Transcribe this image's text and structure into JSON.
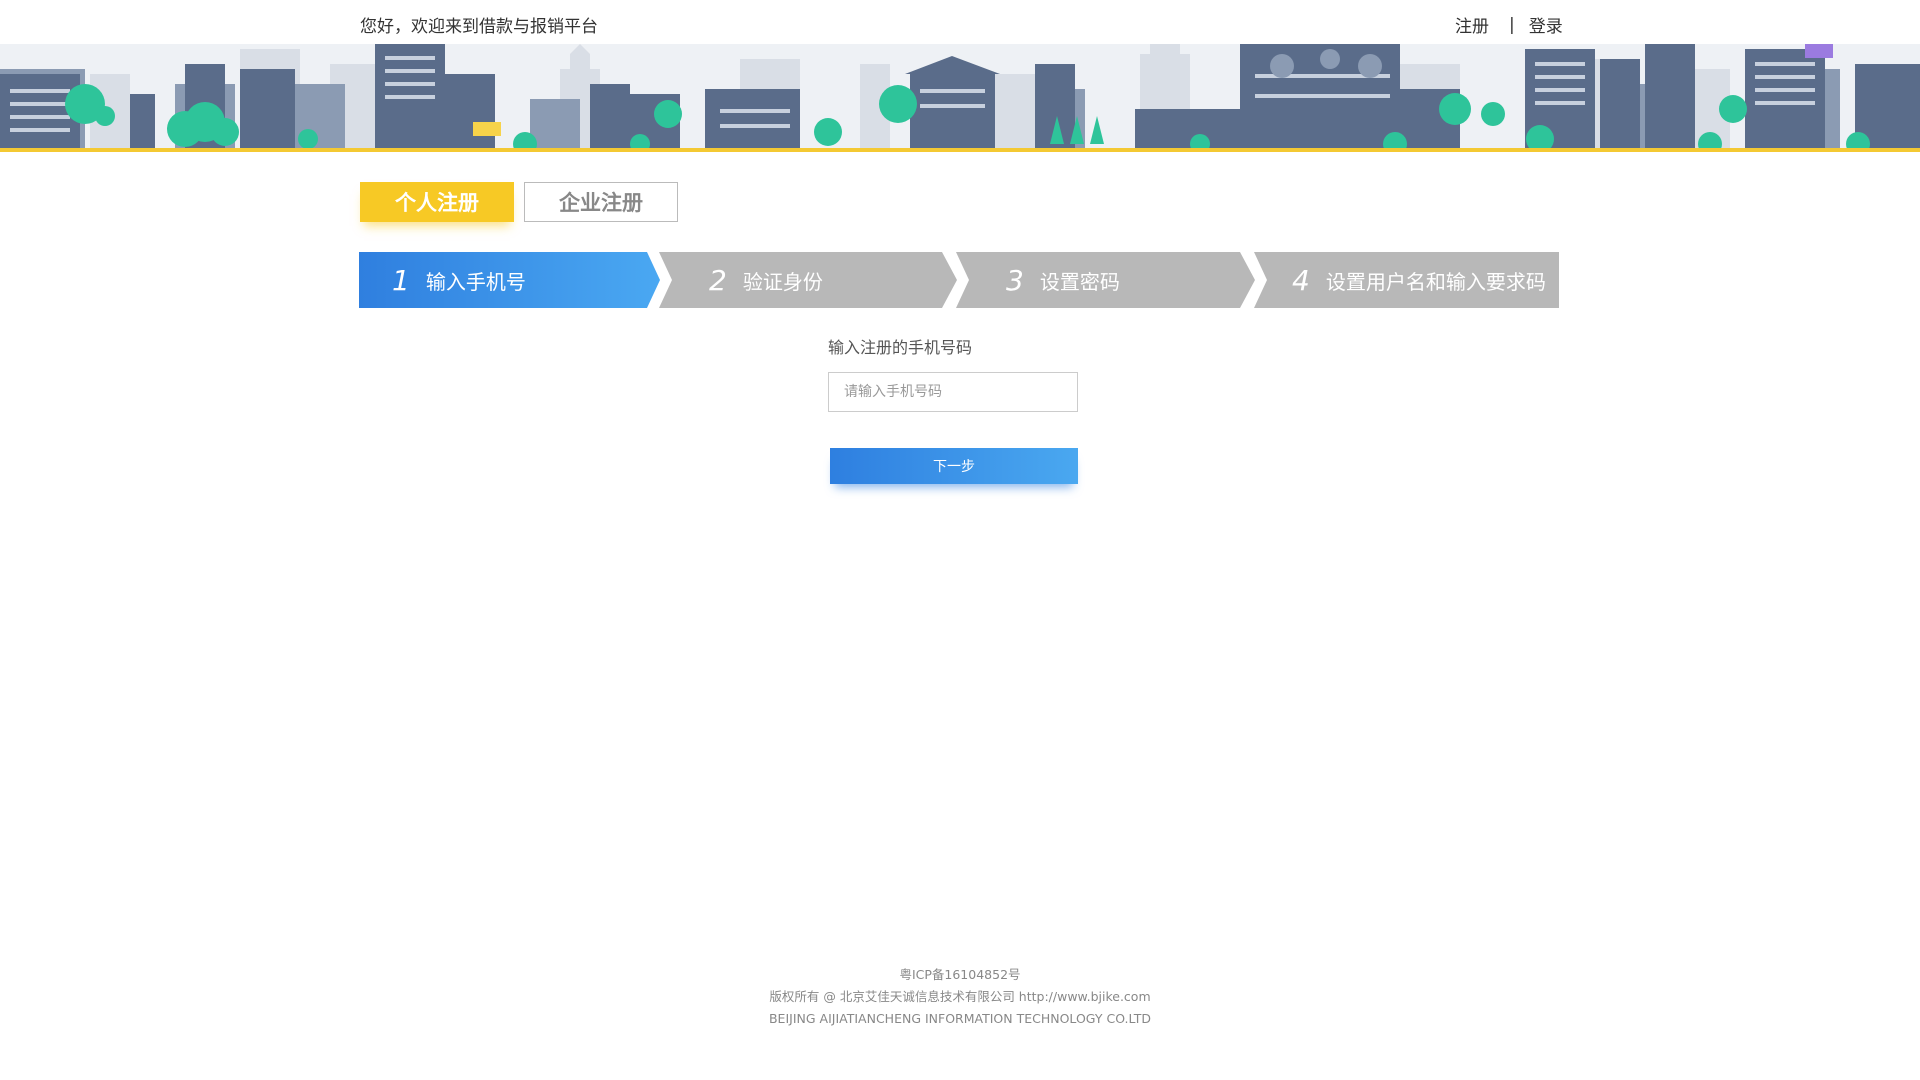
{
  "header": {
    "welcome": "您好，欢迎来到借款与报销平台",
    "register_link": "注册",
    "separator": "|",
    "login_link": "登录"
  },
  "register_tabs": [
    {
      "label": "个人注册",
      "active": true
    },
    {
      "label": "企业注册",
      "active": false
    }
  ],
  "steps": [
    {
      "num": "1",
      "label": "输入手机号",
      "active": true
    },
    {
      "num": "2",
      "label": "验证身份",
      "active": false
    },
    {
      "num": "3",
      "label": "设置密码",
      "active": false
    },
    {
      "num": "4",
      "label": "设置用户名和输入要求码",
      "active": false
    }
  ],
  "form": {
    "label": "输入注册的手机号码",
    "phone_placeholder": "请输入手机号码",
    "phone_value": "",
    "next_button": "下一步"
  },
  "footer": {
    "icp": "粤ICP备16104852号",
    "copyright": "版权所有 @ 北京艾佳天诚信息技术有限公司 http://www.bjike.com",
    "company_en": "BEIJING AIJIATIANCHENG INFORMATION TECHNOLOGY CO.LTD"
  },
  "colors": {
    "accent_yellow": "#f7c925",
    "step_active_blue": "#3a8ee6",
    "step_inactive_gray": "#b8b8b8",
    "button_blue": "#2e7fe0"
  }
}
